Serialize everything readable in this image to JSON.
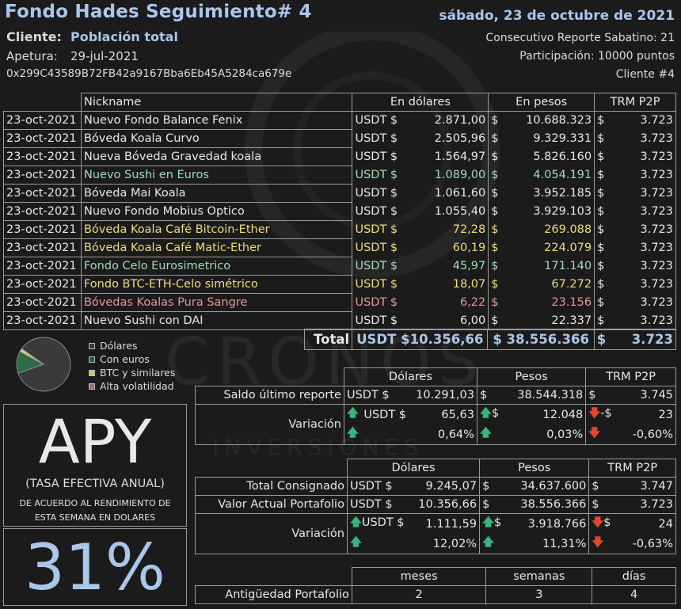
{
  "header": {
    "title": "Fondo Hades Seguimiento# 4",
    "date": "sábado, 23 de octubre de 2021",
    "client_label": "Cliente:",
    "client_value": "Población total",
    "opening_label": "Apetura:",
    "opening_value": "29-jul-2021",
    "wallet": "0x299C43589B72FB42a9167Bba6Eb45A5284ca679e",
    "report_no": "Consecutivo Reporte Sabatino: 21",
    "participation": "Participación: 10000 puntos",
    "client_no": "Cliente #4"
  },
  "watermark": {
    "brand": "CRONOS",
    "sub": "INVERSIONES"
  },
  "holdings": {
    "headers": [
      "Nickname",
      "En dólares",
      "En pesos",
      "TRM P2P"
    ],
    "rows": [
      {
        "date": "23-oct-2021",
        "name": "Nuevo Fondo Balance Fenix",
        "usd_cur": "USDT $",
        "usd": "2.871,00",
        "cop_cur": "$",
        "cop": "10.688.323",
        "trm_cur": "$",
        "trm": "3.723",
        "color": "white"
      },
      {
        "date": "23-oct-2021",
        "name": "Bóveda Koala Curvo",
        "usd_cur": "USDT $",
        "usd": "2.505,96",
        "cop_cur": "$",
        "cop": "9.329.331",
        "trm_cur": "$",
        "trm": "3.723",
        "color": "white"
      },
      {
        "date": "23-oct-2021",
        "name": "Nueva Bóveda Gravedad koala",
        "usd_cur": "USDT $",
        "usd": "1.564,97",
        "cop_cur": "$",
        "cop": "5.826.160",
        "trm_cur": "$",
        "trm": "3.723",
        "color": "white"
      },
      {
        "date": "23-oct-2021",
        "name": "Nuevo Sushi en Euros",
        "usd_cur": "USDT $",
        "usd": "1.089,00",
        "cop_cur": "$",
        "cop": "4.054.191",
        "trm_cur": "$",
        "trm": "3.723",
        "color": "green"
      },
      {
        "date": "23-oct-2021",
        "name": "Bóveda Mai Koala",
        "usd_cur": "USDT $",
        "usd": "1.061,60",
        "cop_cur": "$",
        "cop": "3.952.185",
        "trm_cur": "$",
        "trm": "3.723",
        "color": "white"
      },
      {
        "date": "23-oct-2021",
        "name": "Nuevo Fondo Mobius Optico",
        "usd_cur": "USDT $",
        "usd": "1.055,40",
        "cop_cur": "$",
        "cop": "3.929.103",
        "trm_cur": "$",
        "trm": "3.723",
        "color": "white"
      },
      {
        "date": "23-oct-2021",
        "name": "Bóveda Koala Café Bitcoin-Ether",
        "usd_cur": "USDT $",
        "usd": "72,28",
        "cop_cur": "$",
        "cop": "269.088",
        "trm_cur": "$",
        "trm": "3.723",
        "color": "yellow"
      },
      {
        "date": "23-oct-2021",
        "name": "Bóveda Koala Café Matic-Ether",
        "usd_cur": "USDT $",
        "usd": "60,19",
        "cop_cur": "$",
        "cop": "224.079",
        "trm_cur": "$",
        "trm": "3.723",
        "color": "yellow"
      },
      {
        "date": "23-oct-2021",
        "name": "Fondo Celo Eurosimetrico",
        "usd_cur": "USDT $",
        "usd": "45,97",
        "cop_cur": "$",
        "cop": "171.140",
        "trm_cur": "$",
        "trm": "3.723",
        "color": "green"
      },
      {
        "date": "23-oct-2021",
        "name": "Fondo BTC-ETH-Celo simétrico",
        "usd_cur": "USDT $",
        "usd": "18,07",
        "cop_cur": "$",
        "cop": "67.272",
        "trm_cur": "$",
        "trm": "3.723",
        "color": "yellow"
      },
      {
        "date": "23-oct-2021",
        "name": "Bóvedas Koalas Pura Sangre",
        "usd_cur": "USDT $",
        "usd": "6,22",
        "cop_cur": "$",
        "cop": "23.156",
        "trm_cur": "$",
        "trm": "3.723",
        "color": "red"
      },
      {
        "date": "23-oct-2021",
        "name": "Nuevo Sushi con DAI",
        "usd_cur": "USDT $",
        "usd": "6,00",
        "cop_cur": "$",
        "cop": "22.337",
        "trm_cur": "$",
        "trm": "3.723",
        "color": "white"
      }
    ],
    "total_label": "Total",
    "total_usd": "USDT $10.356,66",
    "total_cop": "$ 38.556.366",
    "total_trm_cur": "$",
    "total_trm": "3.723"
  },
  "legend": {
    "items": [
      {
        "label": "Dólares",
        "color": "#3a3a3a"
      },
      {
        "label": "Con euros",
        "color": "#1f5e3a"
      },
      {
        "label": "BTC y similares",
        "color": "#c9c06a"
      },
      {
        "label": "Alta volatilidad",
        "color": "#a86a6a"
      }
    ]
  },
  "chart_data": {
    "type": "pie",
    "labels": [
      "Dólares",
      "Con euros",
      "BTC y similares",
      "Alta volatilidad"
    ],
    "values": [
      7.0,
      1.1,
      0.15,
      0.01
    ],
    "colors": [
      "#3a3a3a",
      "#2e6b48",
      "#d6cd78",
      "#b47878"
    ]
  },
  "weekly": {
    "headers": [
      "Dólares",
      "Pesos",
      "TRM P2P"
    ],
    "saldo_label": "Saldo último reporte",
    "saldo_usd_cur": "USDT $",
    "saldo_usd": "10.291,03",
    "saldo_cop_cur": "$",
    "saldo_cop": "38.544.318",
    "saldo_trm_cur": "$",
    "saldo_trm": "3.745",
    "var_label": "Variación",
    "var_usd_cur": "USDT $",
    "var_usd": "65,63",
    "var_cop_cur": "$",
    "var_cop": "12.048",
    "var_trm_cur": "-$",
    "var_trm": "23",
    "var_usd_pct": "0,64%",
    "var_cop_pct": "0,03%",
    "var_trm_pct": "-0,60%"
  },
  "portfolio": {
    "headers": [
      "Dólares",
      "Pesos",
      "TRM P2P"
    ],
    "consig_label": "Total Consignado",
    "consig_usd_cur": "USDT $",
    "consig_usd": "9.245,07",
    "consig_cop_cur": "$",
    "consig_cop": "34.637.600",
    "consig_trm_cur": "$",
    "consig_trm": "3.747",
    "actual_label": "Valor Actual Portafolio",
    "actual_usd_cur": "USDT $",
    "actual_usd": "10.356,66",
    "actual_cop_cur": "$",
    "actual_cop": "38.556.366",
    "actual_trm_cur": "$",
    "actual_trm": "3.723",
    "var_label": "Variación",
    "var_usd_cur": "USDT $",
    "var_usd": "1.111,59",
    "var_cop_cur": "$",
    "var_cop": "3.918.766",
    "var_trm_cur": "$",
    "var_trm": "24",
    "var_usd_pct": "12,02%",
    "var_cop_pct": "11,31%",
    "var_trm_pct": "-0,63%"
  },
  "age": {
    "headers": [
      "meses",
      "semanas",
      "días"
    ],
    "label": "Antigüedad Portafolio",
    "months": "2",
    "weeks": "3",
    "days": "4"
  },
  "apy": {
    "big": "APY",
    "sub": "(TASA EFECTIVA ANUAL)",
    "desc1": "DE ACUERDO AL RENDIMIENTO DE",
    "desc2": "ESTA SEMANA EN DOLARES",
    "value": "31%"
  }
}
